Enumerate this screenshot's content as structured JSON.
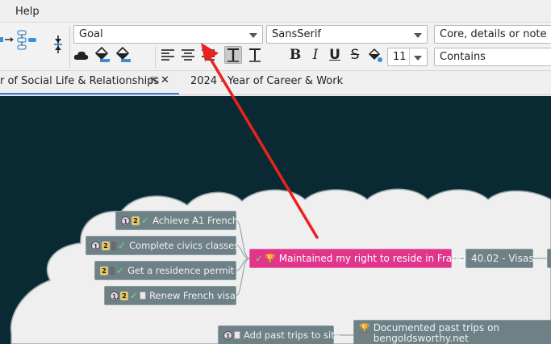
{
  "menubar": {
    "items": [
      "Help"
    ]
  },
  "toolbar": {
    "style_combo": "Goal",
    "font_combo": "SansSerif",
    "filter_field_combo": "Core, details or note",
    "filter_mode_combo": "Contains",
    "font_size_combo": "11",
    "bold_label": "B",
    "italic_label": "I",
    "underline_label": "U",
    "strike_label": "S"
  },
  "tabs": [
    {
      "label": "r of Social Life & Relationships",
      "active": true
    },
    {
      "label": "2024 - Year of Career & Work",
      "active": false
    }
  ],
  "mindmap": {
    "nodes": [
      {
        "text": "Achieve A1 French"
      },
      {
        "text": "Complete civics classes"
      },
      {
        "text": "Get a residence permit"
      },
      {
        "text": "Renew French visa"
      },
      {
        "text": "Maintained my right to reside in France"
      },
      {
        "text": "40.02 - Visas"
      },
      {
        "text": "Add past trips to site"
      },
      {
        "text": "Documented past trips on bengoldsworthy.net"
      }
    ],
    "badge_one": "1",
    "badge_two": "2"
  },
  "colors": {
    "canvas_bg": "#0a2a33",
    "cloud": "#efefef",
    "node_bg": "#6d8186",
    "root_node": "#e0358b",
    "annotation_arrow": "#e8231f",
    "tab_underline": "#3b7dd8"
  }
}
